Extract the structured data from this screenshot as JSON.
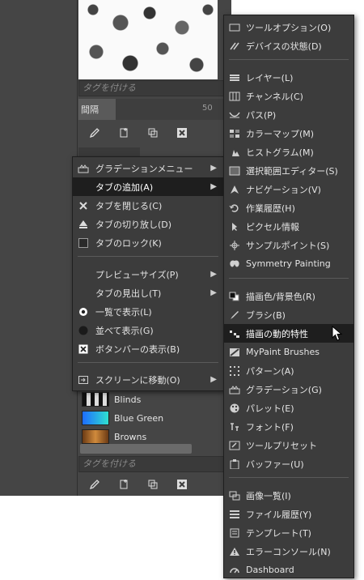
{
  "dock": {
    "tag_placeholder_top": "タグを付ける",
    "spacing_label": "間隔",
    "spacing_value": "50",
    "tag_placeholder_bottom": "タグを付ける",
    "gradients": [
      {
        "label": "Blinds",
        "color": "#9a9a9a"
      },
      {
        "label": "Blue Green",
        "color": "#2fa7e0"
      },
      {
        "label": "Browns",
        "color": "#b06a2a"
      }
    ]
  },
  "tab_menu": {
    "items": [
      {
        "label": "グラデーションメニュー",
        "icon": "gradient-icon",
        "submenu": true
      },
      {
        "label": "タブの追加(A)",
        "icon": "",
        "submenu": true,
        "highlighted": true
      },
      {
        "label": "タブを閉じる(C)",
        "icon": "close-x-icon"
      },
      {
        "label": "タブの切り放し(D)",
        "icon": "eject-icon"
      },
      {
        "label": "タブのロック(K)",
        "icon": "lock-checkbox-icon"
      },
      {
        "label": "プレビューサイズ(P)",
        "icon": "",
        "submenu": true
      },
      {
        "label": "タブの見出し(T)",
        "icon": "",
        "submenu": true
      },
      {
        "label": "一覧で表示(L)",
        "icon": "radio-checked-icon"
      },
      {
        "label": "並べて表示(G)",
        "icon": "radio-unchecked-icon"
      },
      {
        "label": "ボタンバーの表示(B)",
        "icon": "checkbox-checked-icon"
      },
      {
        "label": "スクリーンに移動(O)",
        "icon": "screen-icon",
        "submenu": true
      }
    ]
  },
  "add_tab_menu": {
    "items": [
      {
        "label": "ツールオプション(O)",
        "icon": "tool-options-icon"
      },
      {
        "label": "デバイスの状態(D)",
        "icon": "device-status-icon"
      },
      {
        "label": "レイヤー(L)",
        "icon": "layers-icon"
      },
      {
        "label": "チャンネル(C)",
        "icon": "channels-icon"
      },
      {
        "label": "パス(P)",
        "icon": "paths-icon"
      },
      {
        "label": "カラーマップ(M)",
        "icon": "colormap-icon"
      },
      {
        "label": "ヒストグラム(M)",
        "icon": "histogram-icon"
      },
      {
        "label": "選択範囲エディター(S)",
        "icon": "selection-editor-icon"
      },
      {
        "label": "ナビゲーション(V)",
        "icon": "navigation-icon"
      },
      {
        "label": "作業履歴(H)",
        "icon": "undo-history-icon"
      },
      {
        "label": "ピクセル情報",
        "icon": "pointer-icon"
      },
      {
        "label": "サンプルポイント(S)",
        "icon": "sample-points-icon"
      },
      {
        "label": "Symmetry Painting",
        "icon": "symmetry-icon"
      },
      {
        "label": "描画色/背景色(R)",
        "icon": "fg-bg-color-icon"
      },
      {
        "label": "ブラシ(B)",
        "icon": "brush-icon"
      },
      {
        "label": "描画の動的特性",
        "icon": "paint-dynamics-icon",
        "highlighted": true
      },
      {
        "label": "MyPaint Brushes",
        "icon": "mypaint-brushes-icon"
      },
      {
        "label": "パターン(A)",
        "icon": "patterns-icon"
      },
      {
        "label": "グラデーション(G)",
        "icon": "gradients-icon"
      },
      {
        "label": "パレット(E)",
        "icon": "palettes-icon"
      },
      {
        "label": "フォント(F)",
        "icon": "fonts-icon"
      },
      {
        "label": "ツールプリセット",
        "icon": "tool-presets-icon"
      },
      {
        "label": "バッファー(U)",
        "icon": "buffers-icon"
      },
      {
        "label": "画像一覧(I)",
        "icon": "images-icon"
      },
      {
        "label": "ファイル履歴(Y)",
        "icon": "document-history-icon"
      },
      {
        "label": "テンプレート(T)",
        "icon": "templates-icon"
      },
      {
        "label": "エラーコンソール(N)",
        "icon": "error-console-icon"
      },
      {
        "label": "Dashboard",
        "icon": "dashboard-icon"
      }
    ]
  }
}
